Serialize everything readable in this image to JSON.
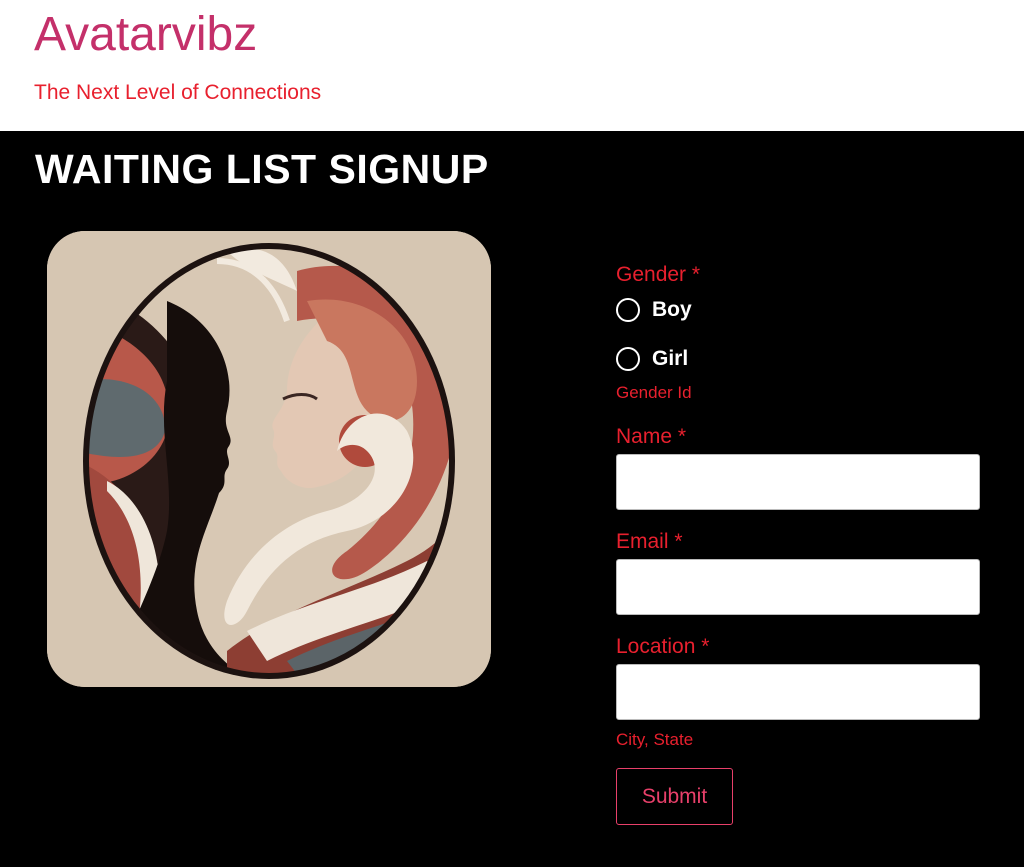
{
  "header": {
    "site_title": "Avatarvibz",
    "tagline": "The Next Level of Connections"
  },
  "page": {
    "title": "WAITING LIST SIGNUP"
  },
  "form": {
    "gender": {
      "label": "Gender *",
      "options": [
        {
          "label": "Boy",
          "selected": false
        },
        {
          "label": "Girl",
          "selected": false
        }
      ],
      "hint": "Gender Id"
    },
    "name": {
      "label": "Name *",
      "value": "",
      "placeholder": ""
    },
    "email": {
      "label": "Email *",
      "value": "",
      "placeholder": ""
    },
    "location": {
      "label": "Location *",
      "value": "",
      "placeholder": "",
      "hint": "City, State"
    },
    "submit_label": "Submit"
  },
  "colors": {
    "brand_pink": "#c4306a",
    "accent_red": "#e8202e",
    "background": "#000000",
    "header_bg": "#ffffff"
  }
}
